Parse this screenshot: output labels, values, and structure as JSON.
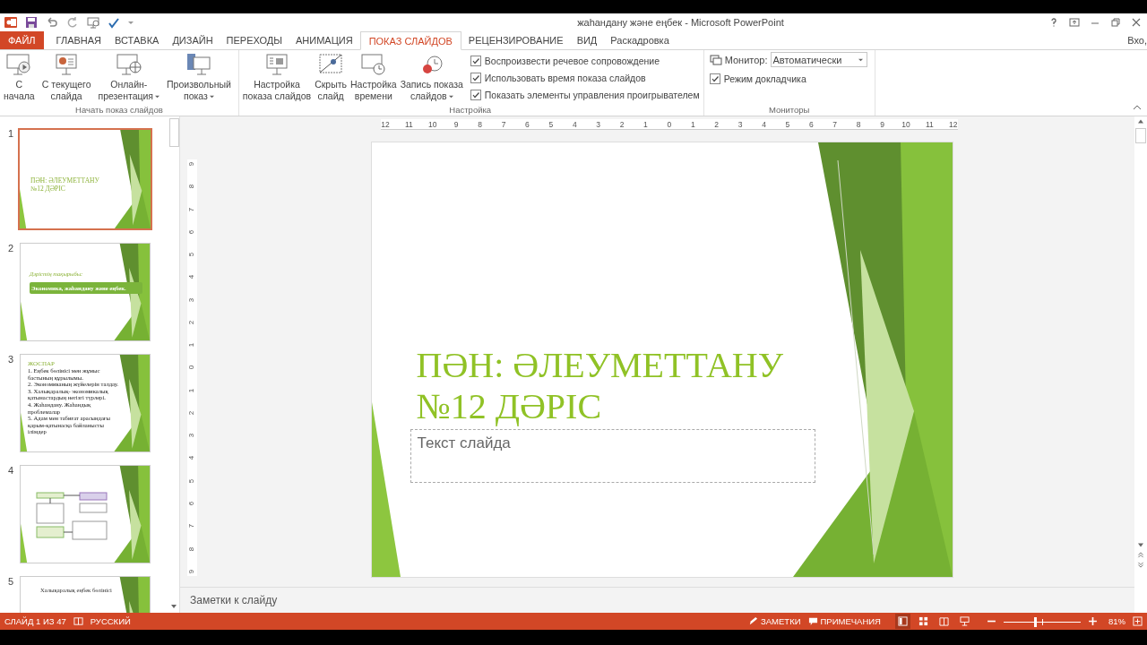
{
  "window": {
    "title": "жаһандану және еңбек - Microsoft PowerPoint"
  },
  "tabs": [
    {
      "label": "ФАЙЛ",
      "kind": "file",
      "selected": false
    },
    {
      "label": "ГЛАВНАЯ",
      "kind": "tab",
      "selected": false
    },
    {
      "label": "ВСТАВКА",
      "kind": "tab",
      "selected": false
    },
    {
      "label": "ДИЗАЙН",
      "kind": "tab",
      "selected": false
    },
    {
      "label": "ПЕРЕХОДЫ",
      "kind": "tab",
      "selected": false
    },
    {
      "label": "АНИМАЦИЯ",
      "kind": "tab",
      "selected": false
    },
    {
      "label": "ПОКАЗ СЛАЙДОВ",
      "kind": "tab",
      "selected": true
    },
    {
      "label": "РЕЦЕНЗИРОВАНИЕ",
      "kind": "tab",
      "selected": false
    },
    {
      "label": "ВИД",
      "kind": "tab",
      "selected": false
    },
    {
      "label": "Раскадровка",
      "kind": "tab",
      "selected": false
    }
  ],
  "account": "Вхо,",
  "ribbon": {
    "start_group": {
      "label": "Начать показ слайдов",
      "buttons": [
        {
          "kind": "from-start",
          "lines": [
            "С",
            "начала"
          ],
          "dropdown": false
        },
        {
          "kind": "from-current",
          "lines": [
            "С текущего",
            "слайда"
          ],
          "dropdown": false
        },
        {
          "kind": "online",
          "lines": [
            "Онлайн-",
            "презентация"
          ],
          "dropdown": true
        },
        {
          "kind": "custom",
          "lines": [
            "Произвольный",
            "показ"
          ],
          "dropdown": true
        }
      ]
    },
    "setup_group": {
      "label": "Настройка",
      "buttons": [
        {
          "kind": "setup",
          "lines": [
            "Настройка",
            "показа слайдов"
          ],
          "dropdown": false
        },
        {
          "kind": "hide",
          "lines": [
            "Скрыть",
            "слайд"
          ],
          "dropdown": false
        },
        {
          "kind": "timings",
          "lines": [
            "Настройка",
            "времени"
          ],
          "dropdown": false
        },
        {
          "kind": "record",
          "lines": [
            "Запись показа",
            "слайдов"
          ],
          "dropdown": true
        }
      ],
      "checkboxes": [
        {
          "label": "Воспроизвести речевое сопровождение",
          "checked": true
        },
        {
          "label": "Использовать время показа слайдов",
          "checked": true
        },
        {
          "label": "Показать элементы управления проигрывателем",
          "checked": true
        }
      ]
    },
    "monitors_group": {
      "label": "Мониторы",
      "monitor_label": "Монитор:",
      "monitor_value": "Автоматически",
      "checkboxes": [
        {
          "label": "Режим докладчика",
          "checked": true
        }
      ]
    }
  },
  "slides": [
    {
      "number": "1",
      "selected": true,
      "kind": "title",
      "lines": [
        "ПӘН: ӘЛЕУМЕТТАНУ",
        "№12 ДӘРІС"
      ]
    },
    {
      "number": "2",
      "selected": false,
      "kind": "topic",
      "heading": "Дәрістің тақырыбы:",
      "box": "Экономика, жаһандану және еңбек."
    },
    {
      "number": "3",
      "selected": false,
      "kind": "list",
      "heading": "ЖОСПАР",
      "lines": [
        "1. Еңбек бөлінісі мен жұмыс бастының құрылымы.",
        "2. Экономиканың жүйелерін  талдау.",
        "3. Халықаралық- экономикалық қатынастардың негізгі түрлері.",
        "4. Жаһандану. Жаһандық проблемалар",
        "5. Адам мен табиғат арасындағы қарым-қатынасқа байланысты ілімдер"
      ]
    },
    {
      "number": "4",
      "selected": false,
      "kind": "diagram"
    },
    {
      "number": "5",
      "selected": false,
      "kind": "heading",
      "heading": "Халықаралық еңбек бөлінісі"
    }
  ],
  "ruler": {
    "horizontal": [
      "12",
      "11",
      "10",
      "9",
      "8",
      "7",
      "6",
      "5",
      "4",
      "3",
      "2",
      "1",
      "0",
      "1",
      "2",
      "3",
      "4",
      "5",
      "6",
      "7",
      "8",
      "9",
      "10",
      "11",
      "12"
    ],
    "vertical": [
      "9",
      "8",
      "7",
      "6",
      "5",
      "4",
      "3",
      "2",
      "1",
      "0",
      "1",
      "2",
      "3",
      "4",
      "5",
      "6",
      "7",
      "8",
      "9"
    ]
  },
  "slide": {
    "title_lines": [
      "ПӘН: ӘЛЕУМЕТТАНУ",
      "№12 ДӘРІС"
    ],
    "placeholder": "Текст слайда"
  },
  "notes": {
    "placeholder": "Заметки к слайду"
  },
  "status_bar": {
    "slide": "СЛАЙД 1 ИЗ 47",
    "language": "РУССКИЙ",
    "notes": "ЗАМЕТКИ",
    "comments": "ПРИМЕЧАНИЯ",
    "views": [
      {
        "kind": "normal",
        "selected": true
      },
      {
        "kind": "sorter",
        "selected": false
      },
      {
        "kind": "reading",
        "selected": false
      },
      {
        "kind": "show",
        "selected": false
      }
    ],
    "zoom": {
      "level": 0.41
    },
    "zoom_reading": "81%"
  }
}
